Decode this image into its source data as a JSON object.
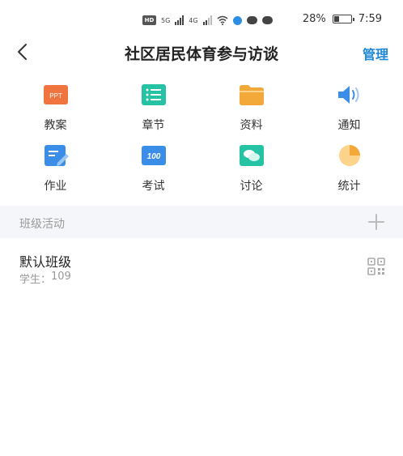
{
  "status_bar": {
    "hd_badge": "HD",
    "network_a": "5G",
    "network_b": "4G",
    "battery_percent": "28%",
    "battery_level": 0.28,
    "time": "7:59"
  },
  "header": {
    "title": "社区居民体育参与访谈",
    "manage_label": "管理",
    "back_icon": "chevron-left-icon"
  },
  "grid": {
    "items": [
      {
        "label": "教案",
        "icon": "ppt-icon",
        "color": "#f0743f"
      },
      {
        "label": "章节",
        "icon": "list-icon",
        "color": "#25c2a4"
      },
      {
        "label": "资料",
        "icon": "folder-icon",
        "color": "#f3a93a"
      },
      {
        "label": "通知",
        "icon": "speaker-icon",
        "color": "#3b8ee8"
      },
      {
        "label": "作业",
        "icon": "edit-icon",
        "color": "#3b8ee8"
      },
      {
        "label": "考试",
        "icon": "exam-score-icon",
        "color": "#3b8ee8",
        "text": "100"
      },
      {
        "label": "讨论",
        "icon": "chat-icon",
        "color": "#25c2a4"
      },
      {
        "label": "统计",
        "icon": "pie-chart-icon",
        "color": "#f3a93a"
      }
    ],
    "ppt_text": "PPT"
  },
  "section": {
    "title": "班级活动",
    "add_icon": "plus-icon"
  },
  "class_item": {
    "name": "默认班级",
    "students_label": "学生：",
    "students_count": "109",
    "qr_icon": "qr-code-icon"
  }
}
